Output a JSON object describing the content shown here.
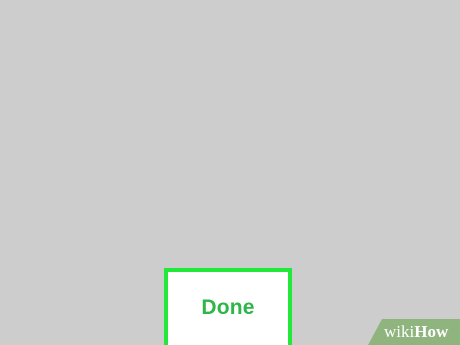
{
  "dialog": {
    "done_label": "Done"
  },
  "watermark": {
    "part1": "wiki",
    "part2": "How"
  },
  "colors": {
    "background": "#cdcdcd",
    "button_fill": "#ffffff",
    "highlight_border": "#22e83a",
    "label_text": "#2fb64a",
    "watermark_bg": "#8fb47e"
  }
}
